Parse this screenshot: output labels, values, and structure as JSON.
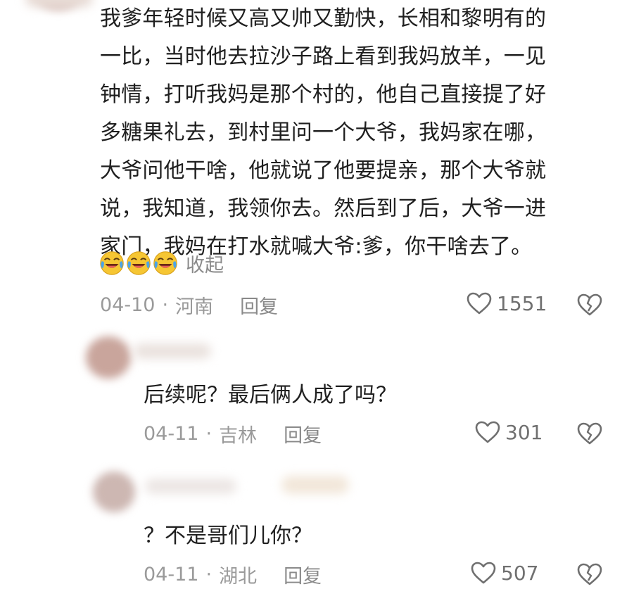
{
  "comment": {
    "text": "我爹年轻时候又高又帅又勤快，长相和黎明有的一比，当时他去拉沙子路上看到我妈放羊，一见钟情，打听我妈是那个村的，他自己直接提了好多糖果礼去，到村里问一个大爷，我妈家在哪，大爷问他干啥，他就说了他要提亲，那个大爷就说，我知道，我领你去。然后到了后，大爷一进家门，我妈在打水就喊大爷:爹，你干啥去了。",
    "lines": [
      "我爹年轻时候又高又帅又勤快，长相和黎明有的",
      "一比，当时他去拉沙子路上看到我妈放羊，一见",
      "钟情，打听我妈是那个村的，他自己直接提了好",
      "多糖果礼去，到村里问一个大爷，我妈家在哪，",
      "大爷问他干啥，他就说了他要提亲，那个大爷就",
      "说，我知道，我领你去。然后到了后，大爷一进",
      "家门，我妈在打水就喊大爷:爹，你干啥去了。"
    ],
    "emojis": [
      "laughing-crying-emoji",
      "laughing-crying-emoji",
      "laughing-crying-emoji"
    ],
    "collapse_label": "收起",
    "date": "04-10",
    "separator": "·",
    "location": "河南",
    "reply_label": "回复",
    "likes": "1551"
  },
  "replies": [
    {
      "text": "后续呢？最后俩人成了吗？",
      "date": "04-11",
      "separator": "·",
      "location": "吉林",
      "reply_label": "回复",
      "likes": "301"
    },
    {
      "text": "？不是哥们儿你？",
      "date": "04-11",
      "separator": "·",
      "location": "湖北",
      "reply_label": "回复",
      "likes": "507"
    }
  ],
  "icons": {
    "like": "heart-outline-icon",
    "dislike": "broken-heart-icon"
  },
  "colors": {
    "text": "#1f1f1f",
    "meta": "#9a9a9a",
    "emoji_face": "#f6c633",
    "emoji_tears": "#4aa3e8"
  }
}
